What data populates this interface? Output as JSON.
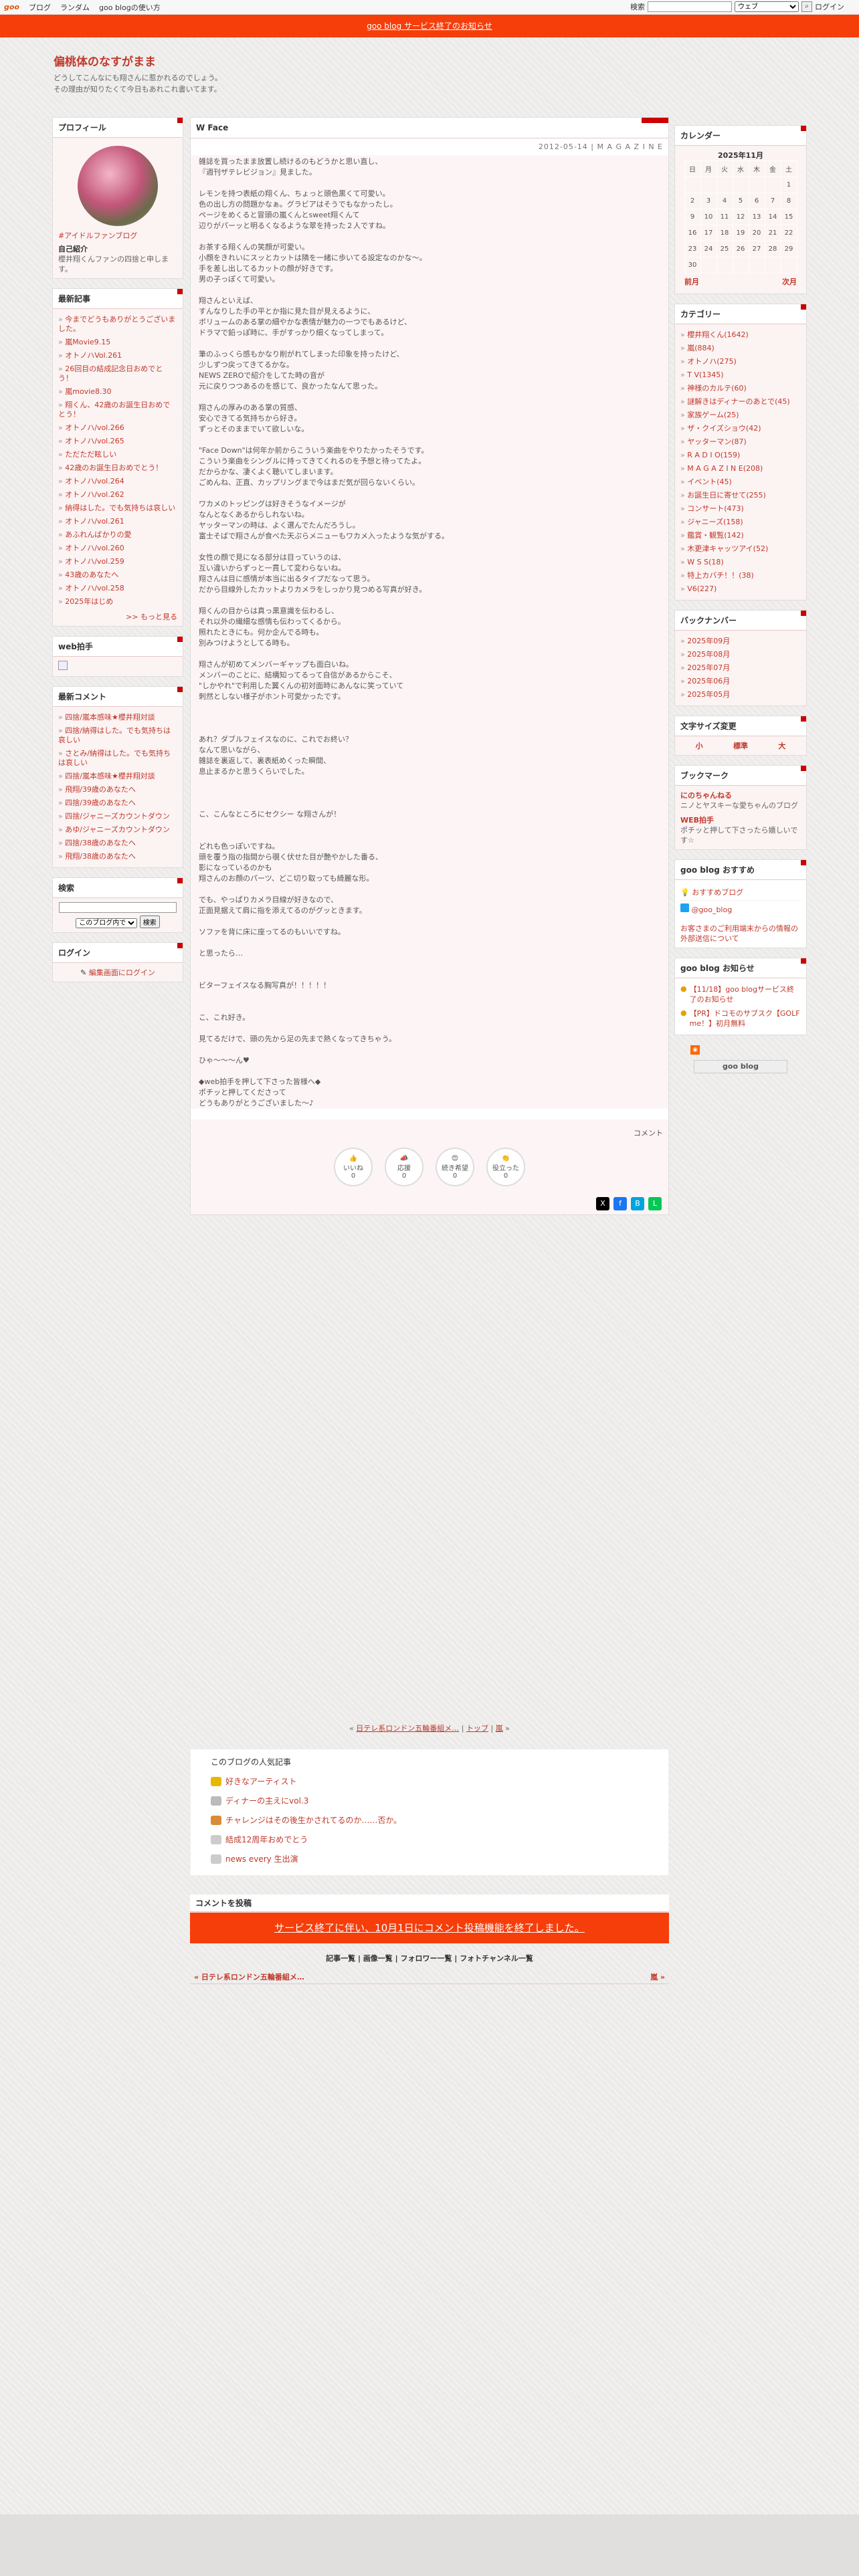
{
  "topbar": {
    "logo": "goo",
    "links": [
      "ブログ",
      "ランダム",
      "goo blogの使い方"
    ],
    "search_label": "検索",
    "select_value": "ウェブ",
    "login": "ログイン"
  },
  "notice": "goo blog サービス終了のお知らせ",
  "blog": {
    "title": "偏桃体のなすがまま",
    "desc": "どうしてこんなにも翔さんに惹かれるのでしょう。\nその理由が知りたくて今日もあれこれ書いてます。"
  },
  "profile": {
    "title": "プロフィール",
    "tag": "#アイドルファンブログ",
    "intro_label": "自己紹介",
    "intro": "櫻井翔くんファンの四捨と申します。"
  },
  "recent": {
    "title": "最新記事",
    "items": [
      "今までどうもありがとうございました。",
      "嵐Movie9.15",
      "オトノハVol.261",
      "26回目の結成記念日おめでとう！",
      "嵐movie8.30",
      "翔くん、42歳のお誕生日おめでとう！",
      "オトノハ/vol.266",
      "オトノハ/vol.265",
      "ただただ眩しい",
      "42歳のお誕生日おめでとう！",
      "オトノハ/vol.264",
      "オトノハ/vol.262",
      "納得はした。でも気持ちは哀しい",
      "オトノハ/vol.261",
      "あふれんばかりの愛",
      "オトノハ/vol.260",
      "オトノハ/vol.259",
      "43歳のあなたへ",
      "オトノハ/vol.258",
      "2025年はじめ"
    ],
    "more": ">> もっと見る"
  },
  "webclap": {
    "title": "web拍手"
  },
  "comments": {
    "title": "最新コメント",
    "items": [
      "四捨/嵐本感味★櫻井翔対談",
      "四捨/納得はした。でも気持ちは哀しい",
      "さとみ/納得はした。でも気持ちは哀しい",
      "四捨/嵐本感味★櫻井翔対談",
      "飛翔/39歳のあなたへ",
      "四捨/39歳のあなたへ",
      "四捨/ジャニーズカウントダウン",
      "あゆ/ジャニーズカウントダウン",
      "四捨/38歳のあなたへ",
      "飛翔/38歳のあなたへ"
    ]
  },
  "search": {
    "title": "検索",
    "select": "このブログ内で",
    "button": "検索"
  },
  "login": {
    "title": "ログイン",
    "link": "編集画面にログイン"
  },
  "entry": {
    "title": "W Face",
    "date": "2012-05-14 | M A G A Z I N E",
    "paragraphs": [
      "雑誌を買ったまま放置し続けるのもどうかと思い直し、\n『週刊ザテレビジョン』見ました。",
      "レモンを持つ表紙の翔くん、ちょっと頭色黒くて可愛い。\n色の出し方の問題かなぁ。グラビアはそうでもなかったし。\nページをめくると冒頭の嵐くんとsweet翔くんて\n辺りがパーッと明るくなるような翠を持った２人ですね。",
      "お茶する翔くんの笑顔が可愛い。\n小顔をきれいにスッとカットは隣を一緒に歩いてる設定なのかな～。\n手を差し出してるカットの顔が好きです。\n男の子っぽくて可愛い。",
      "翔さんといえば、\nすんなりした手の平とか指に見た目が見えるように、\nボリュームのある掌の細やかな表情が魅力の一つでもあるけど、\nドラマで鉛っぽ時に、手がすっかり細くなってしまって。",
      "筆のふっくら感もかなり削がれてしまった印象を持ったけど、\n少しずつ戻ってきてるかな。\nNEWS ZEROで紹介をしてた時の音が\n元に戻りつつあるのを感じて、良かったなんて思った。",
      "翔さんの厚みのある掌の質感、\n安心できてる気持ちから好き。\nずっとそのままでいて欲しいな。",
      "\"Face Down\"は何年か前からこういう楽曲をやりたかったそうです。\nこういう楽曲をシングルに持ってきてくれるのを予想と待ってたよ。\nだからかな、凄くよく聴いてしまいます。\nごめんね、正直、カップリングまで今はまだ気が回らないくらい。",
      "ワカメのトッピングは好きそうなイメージが\nなんとなくあるからしれないね。\nヤッターマンの時は、よく選んでたんだろうし。\n富士そばで翔さんが食べた天ぷらメニューもワカメ入ったような気がする。",
      "女性の顔で見になる部分は目っていうのは、\n互い違いからずっと一貫して変わらないね。\n翔さんは目に感情が本当に出るタイプだなって思う。\nだから目線外したカットよりカメラをしっかり見つめる写真が好き。",
      "翔くんの目からは真っ黒意識を伝わるし、\nそれ以外の繊細な感情も伝わってくるから。\n照れたときにも。何か企んでる時も。\n別みつけようとしてる時も。",
      "翔さんが初めてメンバーギャップも面白いね。\nメンバーのことに、結構知ってるって自信があるからこそ、\n\"しかやれ\"で利用した翼くんの初対面時にあんなに笑っていて\n刺然としない様子がホント可愛かったです。",
      "\n\nあれ？ダブルフェイスなのに、これでお終い？\nなんて思いながら、\n雑誌を裏返して、裏表紙めくった瞬間、\n息止まるかと思うくらいでした。",
      "\n\nこ、こんなところにセクシー な翔さんが！",
      "\nどれも色っぽいですね。\n頭を覆う指の指間から覗く伏せた目が艶やかした番る、\n影になっているのかも\n翔さんのお顔のパーツ、どこ切り取っても綺麗な形。",
      "でも、やっぱりカメラ目線が好きなので、\n正面見据えて肩に指を添えてるのがグッときます。",
      "ソファを背に床に座ってるのもいいですね。",
      "と思ったら…",
      "\nビターフェイスなる胸写真が！！！！！",
      "\nこ、これ好き。",
      "見てるだけで、頭の先から足の先まで熱くなってきちゃう。",
      "ひゃ～～～ん♥",
      "◆web拍手を押して下さった皆様へ◆\nポチッと押してくださって\nどうもありがとうございました～♪"
    ],
    "comment_link": "コメント",
    "reactions": [
      {
        "label": "いいね",
        "count": "0",
        "icon": "👍"
      },
      {
        "label": "応援",
        "count": "0",
        "icon": "📣"
      },
      {
        "label": "続き希望",
        "count": "0",
        "icon": "😍"
      },
      {
        "label": "役立った",
        "count": "0",
        "icon": "👏"
      }
    ]
  },
  "pager": {
    "prev": "日テレ系ロンドン五輪番組メ…",
    "top": "トップ",
    "next": "嵐"
  },
  "popular": {
    "title": "このブログの人気記事",
    "items": [
      "好きなアーティスト",
      "ディナーの主えにvol.3",
      "チャレンジはその後生かされてるのか……否か。",
      "結成12周年おめでとう",
      "news every 生出演"
    ]
  },
  "comment_post": {
    "title": "コメントを投稿",
    "banner": "サービス終了に伴い、10月1日にコメント投稿機能を終了しました。"
  },
  "footer_links": [
    "記事一覧",
    "画像一覧",
    "フォロワー一覧",
    "フォトチャンネル一覧"
  ],
  "footer_pager": {
    "prev": "« 日テレ系ロンドン五輪番組メ…",
    "next": "嵐 »"
  },
  "calendar": {
    "title": "カレンダー",
    "month": "2025年11月",
    "days": [
      "日",
      "月",
      "火",
      "水",
      "木",
      "金",
      "土"
    ],
    "weeks": [
      [
        "",
        "",
        "",
        "",
        "",
        "",
        "1"
      ],
      [
        "2",
        "3",
        "4",
        "5",
        "6",
        "7",
        "8"
      ],
      [
        "9",
        "10",
        "11",
        "12",
        "13",
        "14",
        "15"
      ],
      [
        "16",
        "17",
        "18",
        "19",
        "20",
        "21",
        "22"
      ],
      [
        "23",
        "24",
        "25",
        "26",
        "27",
        "28",
        "29"
      ],
      [
        "30",
        "",
        "",
        "",
        "",
        "",
        ""
      ]
    ],
    "prev": "前月",
    "next": "次月"
  },
  "categories": {
    "title": "カテゴリー",
    "items": [
      "櫻井翔くん(1642)",
      "嵐(884)",
      "オトノハ(275)",
      "T V(1345)",
      "神様のカルテ(60)",
      "謎解きはディナーのあとで(45)",
      "家族ゲーム(25)",
      "ザ・クイズショウ(42)",
      "ヤッターマン(87)",
      "R A D I O(159)",
      "M A G A Z I N E(208)",
      "イベント(45)",
      "お誕生日に寄せて(255)",
      "コンサート(473)",
      "ジャニーズ(158)",
      "鑑賞・観覧(142)",
      "木更津キャッツアイ(52)",
      "W S S(18)",
      "特上カバチ！！(38)",
      "V6(227)"
    ]
  },
  "backnumber": {
    "title": "バックナンバー",
    "items": [
      "2025年09月",
      "2025年08月",
      "2025年07月",
      "2025年06月",
      "2025年05月"
    ]
  },
  "fontsize": {
    "title": "文字サイズ変更",
    "small": "小",
    "normal": "標準",
    "large": "大"
  },
  "bookmark": {
    "title": "ブックマーク",
    "items": [
      {
        "name": "にのちゃんねる",
        "desc": "ニノとヤスキーな愛ちゃんのブログ"
      },
      {
        "name": "WEB拍手",
        "desc": "ポチッと押して下さったら嬉しいです☆"
      }
    ]
  },
  "recommend": {
    "title": "goo blog おすすめ",
    "items": [
      "おすすめブログ",
      "@goo_blog"
    ],
    "note": "お客さまのご利用端末からの情報の外部送信について"
  },
  "news": {
    "title": "goo blog お知らせ",
    "items": [
      "【11/18】goo blogサービス終了のお知らせ",
      "【PR】ドコモのサブスク【GOLF me！】初月無料"
    ]
  },
  "footer_logo": "goo blog",
  "colors": {
    "accent": "#c0392b",
    "notice": "#f63e0a",
    "banner": "#f63e0a"
  }
}
